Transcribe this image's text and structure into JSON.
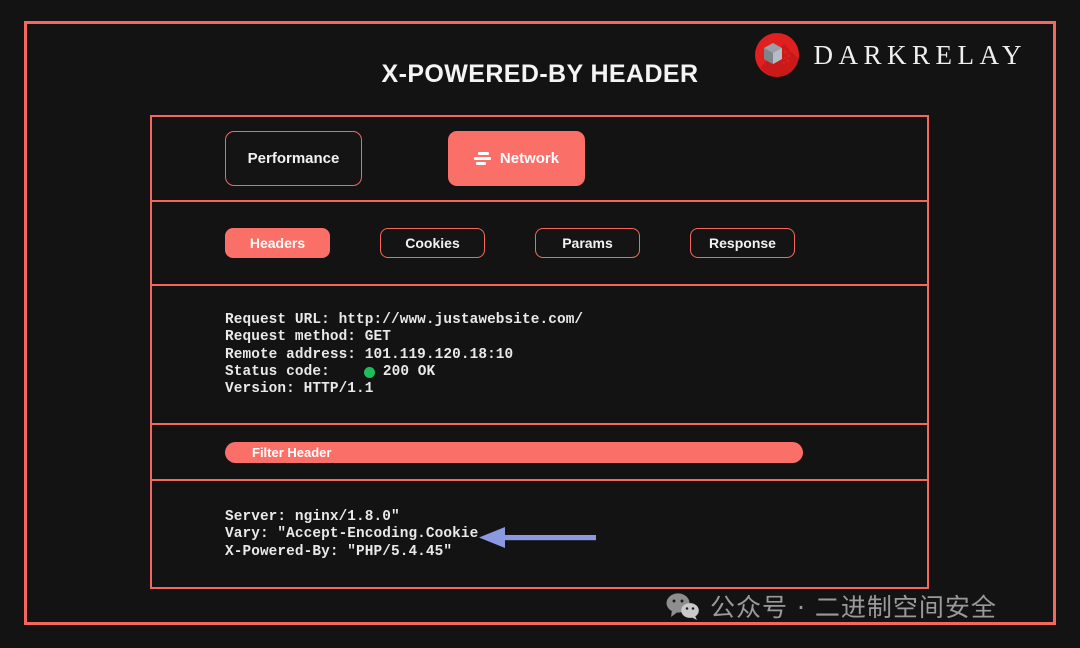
{
  "page": {
    "title": "X-POWERED-BY HEADER",
    "background_color": "#131313",
    "accent_color": "#f4675f",
    "accent_fill_color": "#fa6f68"
  },
  "brand": {
    "name": "DARKRELAY",
    "logo_icon": "darkrelay-cube-logo",
    "logo_circle_color": "#e02020",
    "logo_cube_color": "#9aa0a8"
  },
  "devtools": {
    "primary_tabs": [
      {
        "label": "Performance",
        "icon": null,
        "active": false
      },
      {
        "label": "Network",
        "icon": "network-bars-icon",
        "active": true
      }
    ],
    "secondary_tabs": [
      {
        "label": "Headers",
        "active": true
      },
      {
        "label": "Cookies",
        "active": false
      },
      {
        "label": "Params",
        "active": false
      },
      {
        "label": "Response",
        "active": false
      }
    ],
    "request_details": {
      "url_line": "Request URL: http://www.justawebsite.com/",
      "method_line": "Request method: GET",
      "remote_address_line": "Remote address: 101.119.120.18:10",
      "status_label": "Status code:",
      "status_value": "200 OK",
      "status_dot_color": "#1fbd5a",
      "version_line": "Version: HTTP/1.1"
    },
    "filter": {
      "label": "Filter Header",
      "placeholder": "Filter Header"
    },
    "response_headers": [
      "Server: nginx/1.8.0\"",
      "Vary: \"Accept-Encoding.Cookie",
      "X-Powered-By: \"PHP/5.4.45\""
    ],
    "annotation": {
      "icon": "left-arrow-annotation",
      "color": "#8b9ae0",
      "points_at": "X-Powered-By: \"PHP/5.4.45\""
    }
  },
  "watermark": {
    "icon": "wechat-icon",
    "text": "公众号 · 二进制空间安全",
    "color": "#9a9a9a"
  }
}
